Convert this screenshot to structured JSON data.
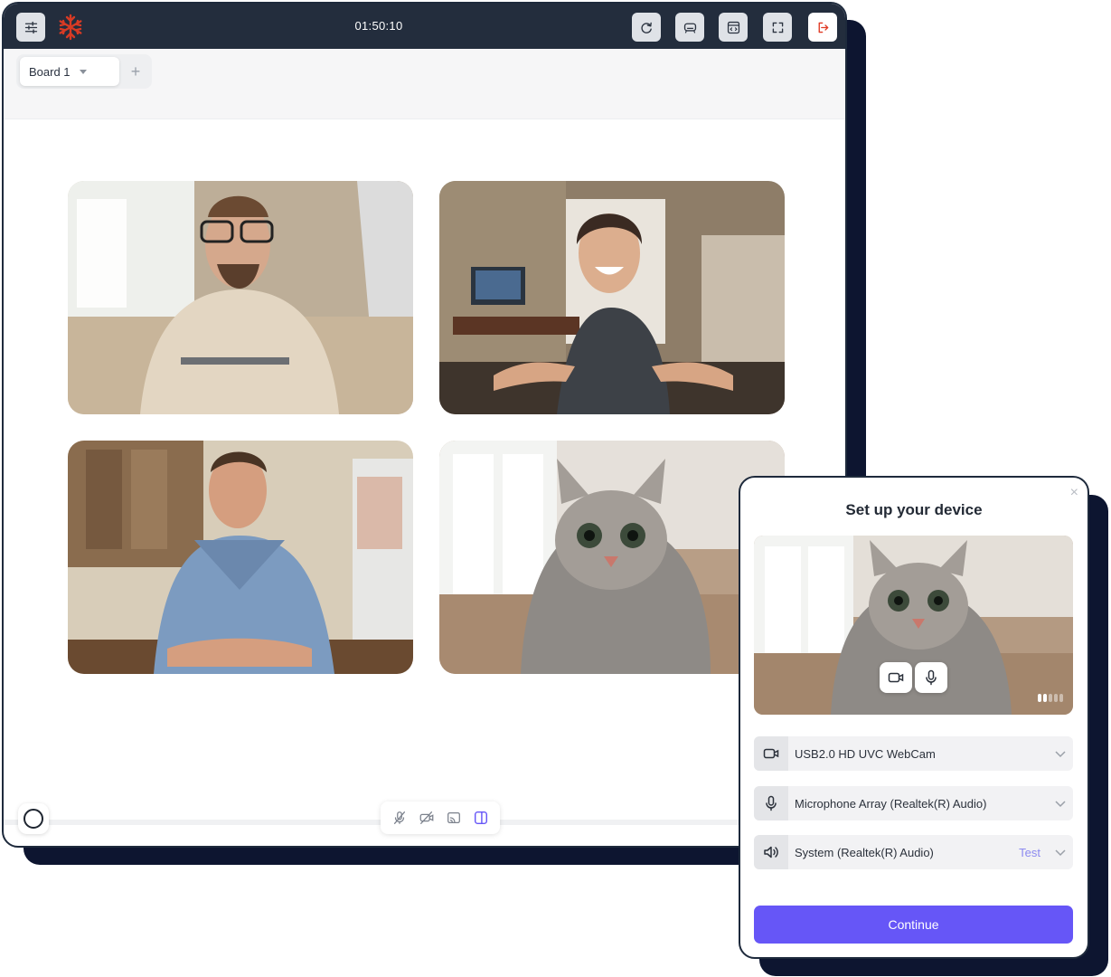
{
  "app": {
    "timer": "01:50:10",
    "brand_color": "#d83a24",
    "accent_color": "#6656f7"
  },
  "toolbar": {
    "left_icons": [
      "sliders-icon",
      "snowflake-logo"
    ],
    "right_icons": [
      "redo-icon",
      "whiteboard-icon",
      "embed-icon",
      "fullscreen-icon",
      "exit-icon"
    ],
    "exit_icon_color": "#e03a24"
  },
  "tabs": {
    "items": [
      {
        "label": "Board 1"
      }
    ],
    "add_label": "+"
  },
  "participants": [
    {
      "name": "man-glasses-video"
    },
    {
      "name": "woman-smiling-video"
    },
    {
      "name": "man-kitchen-video"
    },
    {
      "name": "cat-video"
    }
  ],
  "bottom_controls": {
    "icons": [
      "mic-off-icon",
      "camera-off-icon",
      "cast-icon",
      "split-view-icon"
    ],
    "active_color": "#6656f7"
  },
  "device_setup": {
    "title": "Set up your device",
    "close": "×",
    "audio_level": 0.4,
    "camera": {
      "label": "USB2.0 HD UVC WebCam"
    },
    "microphone": {
      "label": "Microphone Array (Realtek(R) Audio)"
    },
    "speaker": {
      "label": "System (Realtek(R) Audio)",
      "test_label": "Test"
    },
    "continue_label": "Continue"
  }
}
